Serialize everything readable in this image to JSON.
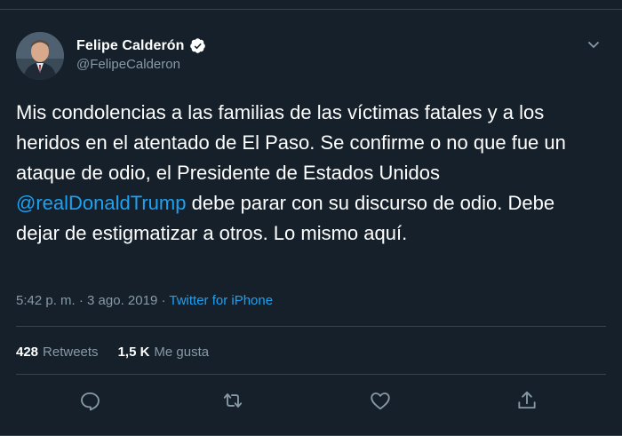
{
  "tweet": {
    "author": {
      "display_name": "Felipe Calderón",
      "handle": "@FelipeCalderon",
      "verified": true
    },
    "text": {
      "part1": "Mis condolencias a las familias de las víctimas fatales y a los heridos en el atentado de El Paso. Se confirme o no que fue un ataque de odio, el Presidente de Estados Unidos ",
      "mention": "@realDonaldTrump",
      "part2": " debe parar con su discurso de odio. Debe dejar de estigmatizar a otros. Lo mismo aquí."
    },
    "meta": {
      "time": "5:42 p. m.",
      "separator": " · ",
      "date": "3 ago. 2019",
      "source": "Twitter for iPhone"
    },
    "stats": {
      "retweets_count": "428",
      "retweets_label": "Retweets",
      "likes_count": "1,5 K",
      "likes_label": "Me gusta"
    }
  },
  "icons": {
    "menu": "chevron-down-icon",
    "verified": "verified-badge-icon",
    "reply": "reply-icon",
    "retweet": "retweet-icon",
    "like": "heart-icon",
    "share": "share-icon"
  },
  "colors": {
    "background": "#15202b",
    "text": "#ffffff",
    "secondary_text": "#8899a6",
    "accent": "#1da1f2",
    "border": "#38444d"
  }
}
